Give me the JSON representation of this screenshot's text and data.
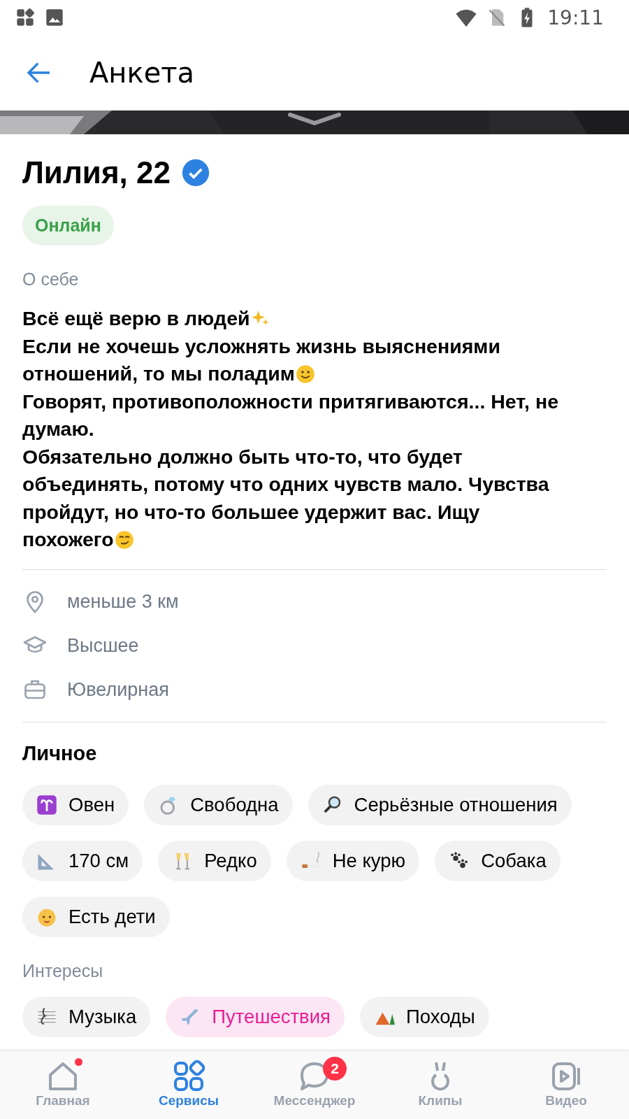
{
  "status_bar": {
    "time": "19:11"
  },
  "app_bar": {
    "title": "Анкета"
  },
  "profile": {
    "name": "Лилия, 22",
    "verified": true,
    "status": "Онлайн"
  },
  "about": {
    "label": "О себе",
    "lines": [
      "Всё ещё верю в людей",
      "Если не хочешь усложнять жизнь выяснениями",
      "отношений, то мы поладим",
      "Говорят, противоположности притягиваются... Нет, не",
      "думаю.",
      "Обязательно должно быть что-то, что будет",
      "объединять, потому что одних чувств мало. Чувства",
      "пройдут, но что-то большее удержит вас. Ищу",
      "похожего"
    ]
  },
  "info": [
    "меньше 3 км",
    "Высшее",
    "Ювелирная"
  ],
  "personal": {
    "title": "Личное",
    "chips": [
      "Овен",
      "Свободна",
      "Серьёзные отношения",
      "170 см",
      "Редко",
      "Не курю",
      "Собака",
      "Есть дети"
    ]
  },
  "interests": {
    "title": "Интересы",
    "chips": [
      {
        "label": "Музыка",
        "selected": false
      },
      {
        "label": "Путешествия",
        "selected": true
      },
      {
        "label": "Походы",
        "selected": false
      }
    ]
  },
  "bottom_nav": [
    {
      "label": "Главная",
      "selected": false,
      "dot": true
    },
    {
      "label": "Сервисы",
      "selected": true,
      "dot": false
    },
    {
      "label": "Мессенджер",
      "selected": false,
      "dot": false,
      "badge": "2"
    },
    {
      "label": "Клипы",
      "selected": false,
      "dot": false
    },
    {
      "label": "Видео",
      "selected": false,
      "dot": false
    }
  ]
}
